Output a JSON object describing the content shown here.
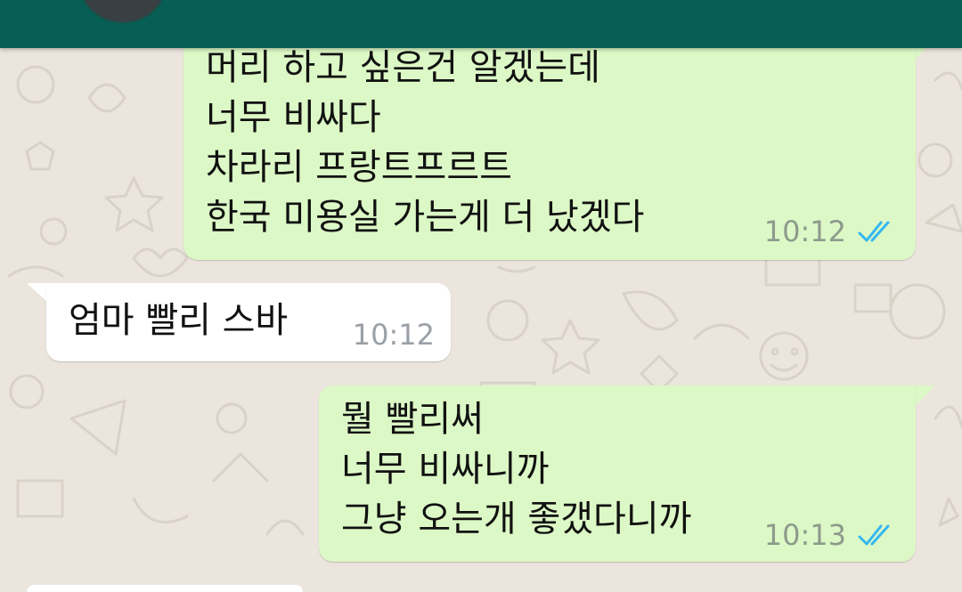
{
  "colors": {
    "header": "#075e54",
    "outgoing_bubble": "#dcf8c6",
    "incoming_bubble": "#ffffff",
    "read_receipt": "#34b7f1",
    "background": "#ece5dd"
  },
  "header": {
    "avatar_icon": "contact-avatar"
  },
  "messages": [
    {
      "direction": "outgoing",
      "lines": [
        "머리 하고 싶은건 알겠는데",
        "너무 비싸다",
        "차라리 프랑트프르트",
        "한국 미용실 가는게 더 났겠다"
      ],
      "time": "10:12",
      "status_icon": "double-check-read-icon"
    },
    {
      "direction": "incoming",
      "lines": [
        "엄마 빨리 스바"
      ],
      "time": "10:12"
    },
    {
      "direction": "outgoing",
      "lines": [
        "뭘 빨리써",
        "너무 비싸니까",
        "그냥 오는개 좋갰다니까"
      ],
      "time": "10:13",
      "status_icon": "double-check-read-icon"
    }
  ]
}
